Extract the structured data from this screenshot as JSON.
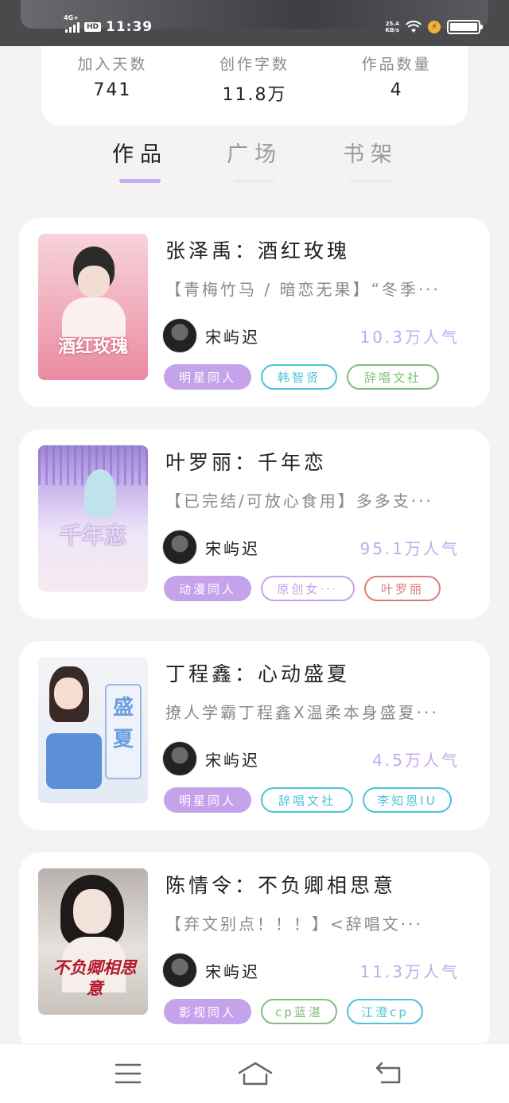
{
  "status_bar": {
    "network": "4G+",
    "hd": "HD",
    "time": "11:39",
    "speed_value": "25.4",
    "speed_unit": "KB/s"
  },
  "stats": [
    {
      "label": "加入天数",
      "value": "741"
    },
    {
      "label": "创作字数",
      "value": "11.8万"
    },
    {
      "label": "作品数量",
      "value": "4"
    }
  ],
  "tabs": [
    {
      "label": "作品",
      "active": true
    },
    {
      "label": "广场",
      "active": false
    },
    {
      "label": "书架",
      "active": false
    }
  ],
  "books": [
    {
      "title": "张泽禹：酒红玫瑰",
      "description": "【青梅竹马 / 暗恋无果】“冬季···",
      "author": "宋屿迟",
      "popularity": "10.3万人气",
      "cover_text": "酒红玫瑰",
      "cover_color": "#f2b3c2",
      "tags": [
        {
          "label": "明星同人",
          "style": "solid",
          "color": "#c4a3ea"
        },
        {
          "label": "韩智贤",
          "style": "outline",
          "color": "#4cc3d9"
        },
        {
          "label": "辞唱文社",
          "style": "outline",
          "color": "#7fbf7a"
        }
      ]
    },
    {
      "title": "叶罗丽：千年恋",
      "description": "【已完结/可放心食用】多多支···",
      "author": "宋屿迟",
      "popularity": "95.1万人气",
      "cover_text": "千年恋",
      "cover_color": "#d8c9ef",
      "tags": [
        {
          "label": "动漫同人",
          "style": "solid",
          "color": "#c4a3ea"
        },
        {
          "label": "原创女···",
          "style": "outline",
          "color": "#c4a3ea"
        },
        {
          "label": "叶罗丽",
          "style": "outline",
          "color": "#e07a7a"
        }
      ]
    },
    {
      "title": "丁程鑫：心动盛夏",
      "description": "撩人学霸丁程鑫X温柔本身盛夏···",
      "author": "宋屿迟",
      "popularity": "4.5万人气",
      "cover_text": "盛夏",
      "cover_color": "#e8eef8",
      "tags": [
        {
          "label": "明星同人",
          "style": "solid",
          "color": "#c4a3ea"
        },
        {
          "label": "辞唱文社",
          "style": "outline",
          "color": "#4cc3d9"
        },
        {
          "label": "李知恩IU",
          "style": "outline",
          "color": "#4cc3d9"
        }
      ]
    },
    {
      "title": "陈情令：不负卿相思意",
      "description": "【弃文别点！！！】<辞唱文···",
      "author": "宋屿迟",
      "popularity": "11.3万人气",
      "cover_text": "不负卿相思意",
      "cover_color": "#cfc7c2",
      "tags": [
        {
          "label": "影视同人",
          "style": "solid",
          "color": "#c4a3ea"
        },
        {
          "label": "cp蓝湛",
          "style": "outline",
          "color": "#7fbf7a"
        },
        {
          "label": "江澄cp",
          "style": "outline",
          "color": "#4cc3d9"
        }
      ]
    }
  ],
  "navbar": {
    "menu_icon": "menu-icon",
    "home_icon": "home-icon",
    "back_icon": "back-icon"
  }
}
